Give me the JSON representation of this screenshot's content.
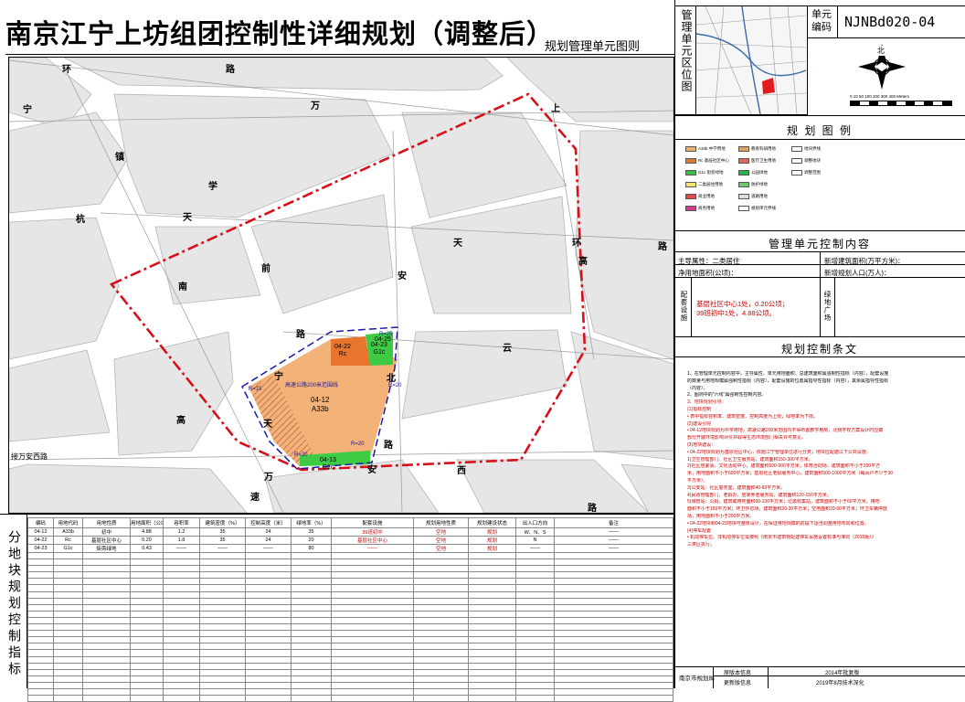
{
  "header": {
    "title": "南京江宁上坊组团控制性详细规划（调整后）",
    "subtitle": "规划管理单元图则"
  },
  "locator": {
    "label": "管理单元区位图",
    "unit_label": "单元编码",
    "unit_code": "NJNBd020-04",
    "north": "北",
    "scale_text": "0  10  50  100  200  300  400 Meters"
  },
  "legend": {
    "title": "规 划 图 例",
    "items": [
      {
        "code": "A33b",
        "text": "中学用地",
        "color": "#f0b070"
      },
      {
        "code": "Rc",
        "text": "基层社区中心",
        "color": "#e07a3a"
      },
      {
        "code": "G1c",
        "text": "街旁绿地",
        "color": "#39c244"
      },
      {
        "code": "",
        "text": "二类居住用地",
        "color": "#f7e36c"
      },
      {
        "code": "",
        "text": "商业用地",
        "color": "#e64646"
      },
      {
        "code": "",
        "text": "商务用地",
        "color": "#d43a8a"
      },
      {
        "code": "",
        "text": "教育科研用地",
        "color": "#e3a35c"
      },
      {
        "code": "",
        "text": "医疗卫生用地",
        "color": "#d66"
      },
      {
        "code": "",
        "text": "公园绿地",
        "color": "#2ab34a"
      },
      {
        "code": "",
        "text": "防护绿地",
        "color": "#6cc86c"
      },
      {
        "code": "",
        "text": "道路用地",
        "color": "#dddddd"
      },
      {
        "code": "",
        "text": "规划单元界线",
        "color": "#ffffff"
      },
      {
        "code": "",
        "text": "地块界线",
        "color": "#ffffff"
      },
      {
        "code": "",
        "text": "调整地块",
        "color": "#ffffff"
      },
      {
        "code": "",
        "text": "调整范围",
        "color": "#ffffff"
      }
    ]
  },
  "control": {
    "title": "管理单元控制内容",
    "dominant_label": "主导属性：",
    "dominant_value": "二类居住",
    "net_area_label": "净用地面积(公顷)：",
    "new_building_label": "新增建筑面积(万平方米)：",
    "new_pop_label": "新增规划人口(万人)：",
    "facilities_label": "配套设施",
    "facilities_value_1": "基层社区中心1处，0.20公顷；",
    "facilities_value_2": "39班初中1处，4.88公顷。",
    "green_label": "绿地广场"
  },
  "articles": {
    "title": "规划控制条文",
    "lines": [
      "1、在管理单元控制内容中，主导属性、单元用地面积、总建筑面积属强制性指标（内容），配套设施",
      "的数量与用地规模属强制性指标（内容），配套设施的位置属指导性指标（内容），其余属指导性指标",
      "（内容）。",
      "2、图则中的\"六线\"属强制性控制内容。",
      "3、地块规划引导：",
      "(1)指标控制",
      "• 表中指标容积率、建筑密度、控制高度为上限，绿地率为下限。",
      "(2)建设引导",
      "• 04-12地块规划为中学用地，高速公路200米范围内不得布置教学用房，北侧学校方案设计时应做",
      "部分开敞环境影响评价并取得生态环境部门相关许可意见。",
      "(3)地块建设：",
      "• 04-22地块规划为基层社区中心，依据江宁管理单位进行分类，地块应配建以下公共设施：",
      "1)卫生管理部门、社区卫生服务站，建筑面积150-300平方米。",
      "2)社区居委会、文化活动中心，建筑面积600-600平方米；体育活动场，建筑面积不小于200平方",
      "米，用地面积不小于600平方米；基层社区老龄服务中心，建筑面积500-1000平方米（每百户不少于30",
      "平方米）。",
      "3)公安站：社区警务室，建筑面积40-60平方米。",
      "4)民政管理部门、老龄办、居家养老服务站，建筑面积120-150平方米。",
      "5)城管站：公厕，建筑或用地面积60-100平方米；垃圾收集站，建筑面积不小于60平方米，用地",
      "面积不小于150平方米；环卫作息场，建筑面积20-30平方米；空地面积20-60平方米；环卫车辆停放",
      "场，用地面积不小于200平方米。",
      "• 04-22地块和04-23地块可整体设计，在保证用地规模的前提下适当调整用地布局和位置。",
      "(4)停车配置",
      "• 机动停车位、非机动停车位需按照《南京市建筑物配建停车设施设置标准与准则（2015版）》",
      "三类区执行。"
    ]
  },
  "map": {
    "roads": [
      "环",
      "路",
      "宁",
      "万",
      "镇",
      "上",
      "学",
      "高",
      "杭",
      "天",
      "天",
      "环",
      "路",
      "前",
      "南",
      "安",
      "高",
      "云",
      "路",
      "宁",
      "北",
      "天",
      "路",
      "接万安西路",
      "西",
      "路",
      "万",
      "速",
      "安"
    ],
    "parcels": [
      {
        "id": "04-12",
        "code": "A33b"
      },
      {
        "id": "04-22",
        "code": "Rc"
      },
      {
        "id": "04-23",
        "code": "G1c"
      },
      {
        "id": "04-13",
        "code": "G1c"
      },
      {
        "id": "04-25",
        "code": ""
      }
    ],
    "highway_buffer": "高速公路200米范围线",
    "radii": [
      "R=15",
      "R=20",
      "R=20",
      "R=25",
      "R=20"
    ]
  },
  "parcel_table": {
    "side_label": "分地块规划控制指标",
    "headers": [
      "编码",
      "用地代码",
      "用地性质",
      "用地面积（公顷）",
      "容积率",
      "建筑密度（%）",
      "控制高度（米）",
      "绿地率（%）",
      "配套设施",
      "规划用地性质",
      "规划建设状态",
      "出入口方向",
      "备注"
    ],
    "rows": [
      [
        "04-12",
        "A33b",
        "初中",
        "4.88",
        "1.2",
        "35",
        "24",
        "35",
        "39班初中",
        "空地",
        "规划",
        "W、N、S",
        "——"
      ],
      [
        "04-22",
        "Rc",
        "基层社区中心",
        "0.20",
        "1.8",
        "35",
        "24",
        "20",
        "基层社区中心",
        "空地",
        "规划",
        "N",
        "——"
      ],
      [
        "04-23",
        "G1c",
        "街旁绿地",
        "0.43",
        "——",
        "——",
        "——",
        "80",
        "——",
        "空地",
        "规划",
        "——",
        "——"
      ]
    ],
    "empty_rows": 23
  },
  "footer": {
    "agency": "南京市规划局",
    "original_label": "原版本信息",
    "original_value": "2014年批复版",
    "update_label": "更新版信息",
    "update_value": "2019年8月技术深化"
  },
  "colors": {
    "school": "#f3b277",
    "community": "#e8752e",
    "green": "#3ecb44",
    "unit_border": "#d6101a",
    "road_fill": "#ffffff",
    "block_fill": "#e6e6e6",
    "parcel_border": "#1a1aa8"
  }
}
